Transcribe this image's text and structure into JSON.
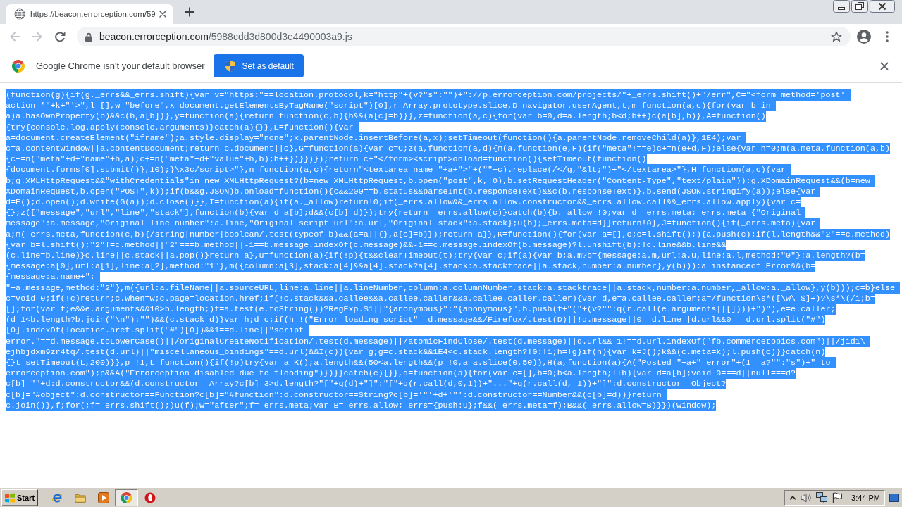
{
  "tabs": [
    {
      "title": "https://beacon.errorception.com/59",
      "selected": true
    }
  ],
  "nav_buttons": [
    {
      "kind": "back",
      "disabled": true
    },
    {
      "kind": "forward",
      "disabled": true
    },
    {
      "kind": "reload",
      "disabled": false
    }
  ],
  "address_bar": {
    "host": "beacon.errorception.com",
    "path": "/5988cdd3d800d3e4490003a9.js"
  },
  "infobar": {
    "message": "Google Chrome isn't your default browser",
    "button": "Set as default"
  },
  "page": {
    "selected": true,
    "text": "(function(g){if(g._errs&&_errs.shift){var v=\"https:\"==location.protocol,k=\"http\"+(v?\"s\":\"\")+\"://p.errorception.com/projects/\"+_errs.shift()+\"/err\",C=\"<form method='post' action='\"+k+\"'>\",l=[],w=\"before\",x=document.getElementsByTagName(\"script\")[0],r=Array.prototype.slice,D=navigator.userAgent,t,m=function(a,c){for(var b in a)a.hasOwnProperty(b)&&c(b,a[b])},y=function(a){return function(c,b){b&&(a[c]=b)}},z=function(a,c){for(var b=0,d=a.length;b<d;b++)c(a[b],b)},A=function(){try{console.log.apply(console,arguments)}catch(a){}},E=function(){var a=document.createElement(\"iframe\");a.style.display=\"none\";x.parentNode.insertBefore(a,x);setTimeout(function(){a.parentNode.removeChild(a)},1E4);var c=a.contentWindow||a.contentDocument;return c.document||c},G=function(a){var c=C;z(a,function(a,d){m(a,function(e,F){if(\"meta\"!==e)c+=n(e+d,F);else{var h=0;m(a.meta,function(a,b){c+=n(\"meta\"+d+\"name\"+h,a);c+=n(\"meta\"+d+\"value\"+h,b);h++})}})});return c+\"</form><script>onload=function(){setTimeout(function(){document.forms[0].submit()},10);}\\x3c/script>\"},n=function(a,c){return\"<textarea name=\"+a+\">\"+(\"\"+c).replace(/</g,\"&lt;\")+\"</textarea>\"},H=function(a,c){var b;g.XMLHttpRequest&&\"withCredentials\"in new XMLHttpRequest?(b=new XMLHttpRequest,b.open(\"post\",k,!0),b.setRequestHeader(\"Content-Type\",\"text/plain\")):g.XDomainRequest&&(b=new XDomainRequest,b.open(\"POST\",k));if(b&&g.JSON)b.onload=function(){c&&200==b.status&&parseInt(b.responseText)&&c(b.responseText)},b.send(JSON.stringify(a));else{var d=E();d.open();d.write(G(a));d.close()}},I=function(a){if(a._allow)return!0;if(_errs.allow&&_errs.allow.constructor&&_errs.allow.call&&_errs.allow.apply){var c={};z([\"message\",\"url\",\"line\",\"stack\"],function(b){var d=a[b];d&&(c[b]=d)});try{return _errs.allow(c)}catch(b){b._allow=!0;var d=_errs.meta;_errs.meta={\"Original message\":a.message,\"Original line number\":a.line,\"Original script url\":a.url,\"Original stack\":a.stack};u(b);_errs.meta=d}}return!0},J=function(){if(_errs.meta){var a;m(_errs.meta,function(c,b){/string|number|boolean/.test(typeof b)&&(a=a||{},a[c]=b)});return a}},K=function(){for(var a=[],c;c=l.shift();){a.push(c);if(l.length&&\"2\"==c.method){var b=l.shift();\"2\"!=c.method||\"2\"===b.method||-1==b.message.indexOf(c.message)&&-1==c.message.indexOf(b.message)?l.unshift(b):!c.line&&b.line&&(c.line=b.line)}c.line||c.stack||a.pop()}return a},u=function(a){if(!p){t&&clearTimeout(t);try{var c;if(a){var b;a.m?b={message:a.m,url:a.u,line:a.l,method:\"0\"}:a.length?(b={message:a[0],url:a[1],line:a[2],method:\"1\"},m({column:a[3],stack:a[4]&&a[4].stack?a[4].stack:a.stacktrace||a.stack,number:a.number},y(b))):a instanceof Error&&(b={message:a.name+\": \"+a.message,method:\"2\"},m({url:a.fileName||a.sourceURL,line:a.line||a.lineNumber,column:a.columnNumber,stack:a.stacktrace||a.stack,number:a.number,_allow:a._allow},y(b)));c=b}else c=void 0;if(!c)return;c.when=w;c.page=location.href;if(!c.stack&&a.callee&&a.callee.caller&&a.callee.caller.caller){var d,e=a.callee.caller;a=/function\\s*([\\w\\-$]+)?\\s*\\(/i;b=[];for(var f;e&&e.arguments&&10>b.length;)f=a.test(e.toString())?RegExp.$1||\"{anonymous}\":\"{anonymous}\",b.push(f+\"(\"+(v?\"\":q(r.call(e.arguments||[])))+\")\"),e=e.caller;(d=1<b.length?b.join(\"\\n\"):\"\")&&(c.stack=d)}var h;d=c;if(h=!(\"Error loading script\"==d.message&&/Firefox/.test(D)||!d.message||0==d.line||d.url&&0===d.url.split(\"#\")[0].indexOf(location.href.split(\"#\")[0])&&1==d.line||\"script error.\"==d.message.toLowerCase()||/originalCreateNotification/.test(d.message)||/atomicFindClose/.test(d.message)||d.url&&-1!==d.url.indexOf(\"fb.commercetopics.com\")||/jid1\\-ejhbjdxm9zr4tq/.test(d.url)||\"miscellaneous_bindings\"==d.url)&&I(c)){var g;g=c.stack&&1E4<c.stack.length?!0:!1;h=!g}if(h){var k=J();k&&(c.meta=k);l.push(c)}}catch(n){}t=setTimeout(L,200)}},p=!1,L=function(){if(!p)try{var a=K();a.length&&(50<a.length&&(p=!0,a=a.slice(0,50)),H(a,function(a){A(\"Posted \"+a+\" error\"+(1==a?\"\":\"s\")+\" to errorception.com\");p&&A(\"Errorception disabled due to flooding\")})}}catch(c){}},q=function(a){for(var c=[],b=0;b<a.length;++b){var d=a[b];void 0===d||null===d?c[b]=\"\"+d:d.constructor&&(d.constructor==Array?c[b]=3>d.length?\"[\"+q(d)+\"]\":\"[\"+q(r.call(d,0,1))+\"...\"+q(r.call(d,-1))+\"]\":d.constructor==Object?c[b]=\"#object\":d.constructor==Function?c[b]=\"#function\":d.constructor==String?c[b]='\"'+d+'\"':d.constructor==Number&&(c[b]=d))}return c.join()},f;for(;f=_errs.shift();)u(f);w=\"after\";f=_errs.meta;var B=_errs.allow;_errs={push:u};f&&(_errs.meta=f);B&&(_errs.allow=B)}})(window);"
  },
  "taskbar": {
    "start": "Start",
    "apps": [
      {
        "kind": "elogo",
        "selected": false
      },
      {
        "kind": "folder",
        "selected": false
      },
      {
        "kind": "player",
        "selected": false
      },
      {
        "kind": "browser",
        "selected": true
      },
      {
        "kind": "ologo",
        "selected": false
      }
    ],
    "clock": "3:44 PM"
  }
}
